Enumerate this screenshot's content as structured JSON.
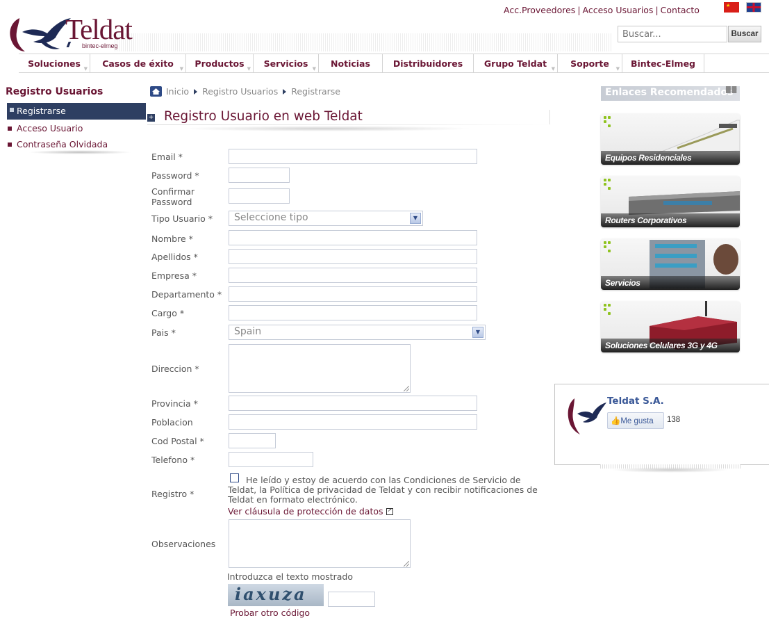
{
  "header": {
    "links": [
      "Acc.Proveedores",
      "Acceso Usuarios",
      "Contacto"
    ],
    "search_placeholder": "Buscar...",
    "search_button": "Buscar",
    "logo_text": "Teldat",
    "logo_sub": "bintec-elmeg",
    "logo_bars": "///"
  },
  "nav": [
    {
      "label": "Soluciones",
      "caret": true
    },
    {
      "label": "Casos de éxito",
      "caret": true
    },
    {
      "label": "Productos",
      "caret": true
    },
    {
      "label": "Servicios",
      "caret": true
    },
    {
      "label": "Noticias",
      "caret": false
    },
    {
      "label": "Distribuidores",
      "caret": false
    },
    {
      "label": "Grupo Teldat",
      "caret": true
    },
    {
      "label": "Soporte",
      "caret": true
    },
    {
      "label": "Bintec-Elmeg",
      "caret": false
    }
  ],
  "sidebar": {
    "title": "Registro Usuarios",
    "active": "Registrarse",
    "items": [
      "Acceso Usuario",
      "Contraseña Olvidada"
    ]
  },
  "breadcrumb": [
    "Inicio",
    "Registro Usuarios",
    "Registrarse"
  ],
  "page_title": "Registro Usuario en web Teldat",
  "form": {
    "email": "Email *",
    "password": "Password *",
    "confirm_1": "Confirmar",
    "confirm_2": "Password",
    "tipo": "Tipo Usuario *",
    "tipo_value": "Seleccione tipo",
    "nombre": "Nombre *",
    "apellidos": "Apellidos *",
    "empresa": "Empresa *",
    "departamento": "Departamento *",
    "cargo": "Cargo *",
    "pais": "Pais *",
    "pais_value": "Spain",
    "direccion": "Direccion *",
    "provincia": "Provincia *",
    "poblacion": "Poblacion",
    "cod_postal": "Cod Postal *",
    "telefono": "Telefono *",
    "registro": "Registro *",
    "terms": "He leído y estoy de acuerdo con las Condiciones de Servicio de Teldat, la Política de privacidad de Teldat y con recibir notificaciones de Teldat en formato electrónico.",
    "terms_link": "Ver cláusula de protección de datos",
    "observaciones": "Observaciones",
    "captcha_label": "Introduzca el texto mostrado",
    "captcha_text": "iaxuza",
    "captcha_refresh": "Probar otro código"
  },
  "right": {
    "title": "Enlaces Recomendados",
    "cards": [
      "Equipos Residenciales",
      "Routers Corporativos",
      "Servicios",
      "Soluciones Celulares 3G y 4G"
    ],
    "fb_name": "Teldat S.A.",
    "fb_like": "Me gusta",
    "fb_count": "138"
  },
  "colors": {
    "brand": "#6a1634",
    "navy": "#2e3f62",
    "accent_green": "#8fc31f"
  }
}
